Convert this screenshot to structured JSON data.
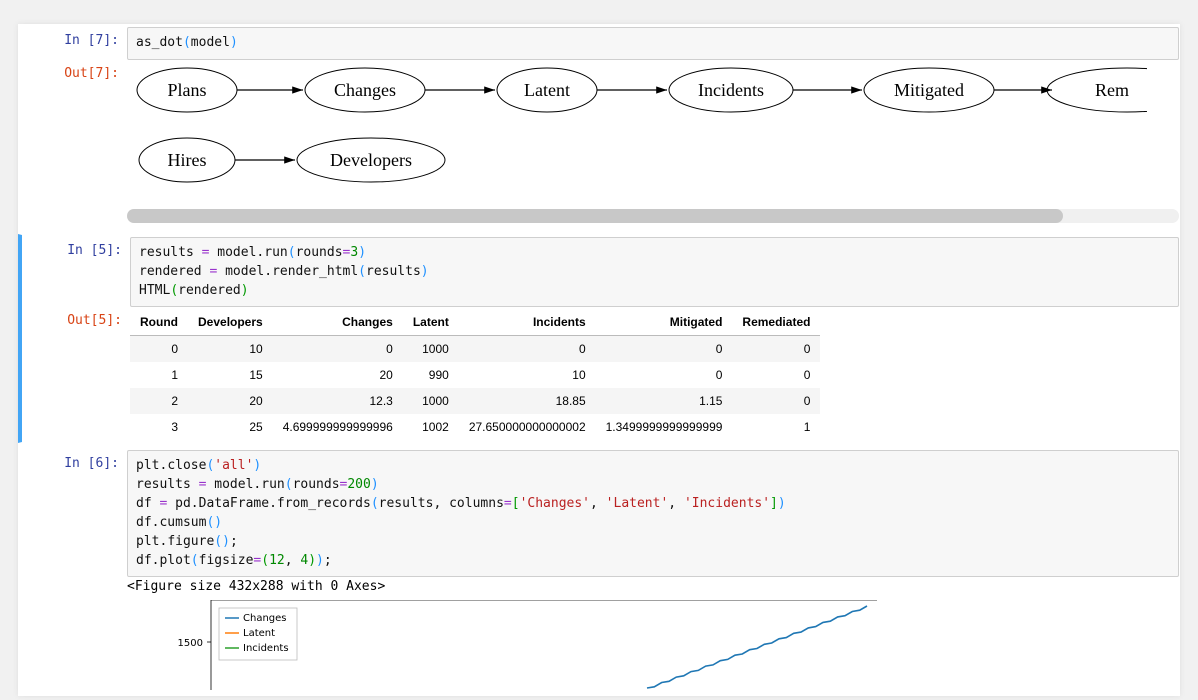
{
  "cells": {
    "c7": {
      "in_prompt": "In [7]:",
      "out_prompt": "Out[7]:",
      "code": "as_dot(model)"
    },
    "c5": {
      "in_prompt": "In [5]:",
      "out_prompt": "Out[5]:"
    },
    "c6": {
      "in_prompt": "In [6]:",
      "figure_text": "<Figure size 432x288 with 0 Axes>"
    }
  },
  "graph": {
    "row1": [
      "Plans",
      "Changes",
      "Latent",
      "Incidents",
      "Mitigated",
      "Rem"
    ],
    "row2": [
      "Hires",
      "Developers"
    ]
  },
  "table": {
    "columns": [
      "Round",
      "Developers",
      "Changes",
      "Latent",
      "Incidents",
      "Mitigated",
      "Remediated"
    ],
    "rows": [
      [
        "0",
        "10",
        "0",
        "1000",
        "0",
        "0",
        "0"
      ],
      [
        "1",
        "15",
        "20",
        "990",
        "10",
        "0",
        "0"
      ],
      [
        "2",
        "20",
        "12.3",
        "1000",
        "18.85",
        "1.15",
        "0"
      ],
      [
        "3",
        "25",
        "4.699999999999996",
        "1002",
        "27.650000000000002",
        "1.3499999999999999",
        "1"
      ]
    ]
  },
  "chart_data": {
    "type": "line",
    "y_tick": {
      "value": 1500,
      "label": "1500"
    },
    "legend": [
      "Changes",
      "Latent",
      "Incidents"
    ],
    "visible_ymin": 1350,
    "visible_ymax": 1600,
    "colors": {
      "Changes": "#1f77b4",
      "Latent": "#ff7f0e",
      "Incidents": "#2ca02c"
    },
    "note": "Only top strip of plot is visible; a single ascending Changes line and y-tick 1500 are rendered."
  }
}
